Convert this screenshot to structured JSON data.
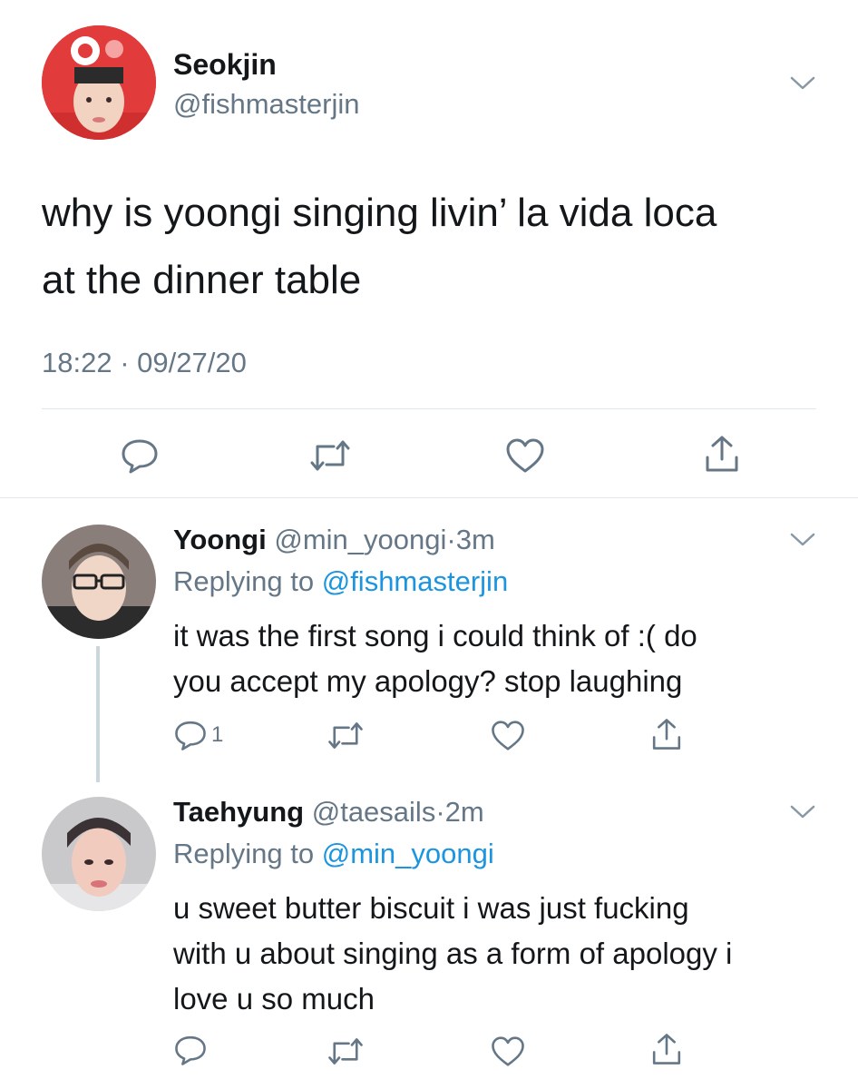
{
  "main_tweet": {
    "display_name": "Seokjin",
    "handle": "@fishmasterjin",
    "text_line1": "why is yoongi singing livin’ la vida loca",
    "text_line2": "at the dinner table",
    "time": "18:22",
    "date": "09/27/20",
    "separator": "·"
  },
  "replies": [
    {
      "display_name": "Yoongi",
      "handle": "@min_yoongi",
      "age": "3m",
      "replying_label": "Replying to",
      "replying_to": "@fishmasterjin",
      "text_line1": "it was the first song i could think of :( do",
      "text_line2": "you accept my apology? stop laughing",
      "reply_count": "1"
    },
    {
      "display_name": "Taehyung",
      "handle": "@taesails",
      "age": "2m",
      "replying_label": "Replying to",
      "replying_to": "@min_yoongi",
      "text_line1": "u sweet butter biscuit i was just fucking",
      "text_line2": "with u about singing as a form of apology i",
      "text_line3": "love u so much"
    }
  ],
  "colors": {
    "link": "#1b95e0",
    "secondary_text": "#657786",
    "icon": "#657786",
    "divider": "#e1e8ed",
    "thread_line": "#ccd6dd"
  },
  "icons": [
    "reply-icon",
    "retweet-icon",
    "like-icon",
    "share-icon",
    "chevron-down-icon"
  ]
}
